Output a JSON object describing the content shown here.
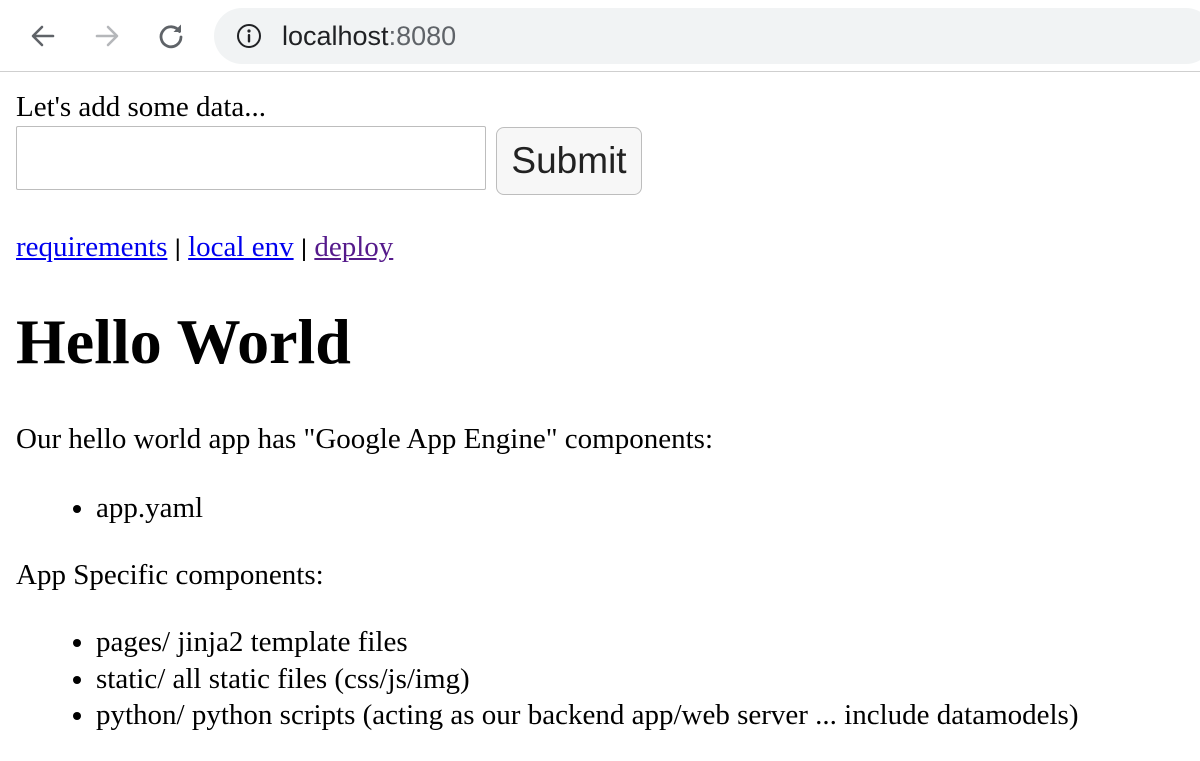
{
  "browser": {
    "url_host": "localhost",
    "url_port": ":8080",
    "icons": {
      "back": "arrow-left-icon",
      "forward": "arrow-right-icon",
      "reload": "reload-icon",
      "site_info": "info-circle-icon"
    }
  },
  "form": {
    "prompt": "Let's add some data...",
    "input_value": "",
    "submit_label": "Submit"
  },
  "links": [
    {
      "label": "requirements",
      "visited": false
    },
    {
      "label": "local env",
      "visited": false
    },
    {
      "label": "deploy",
      "visited": true
    }
  ],
  "link_separator": "|",
  "page": {
    "heading": "Hello World",
    "intro": "Our hello world app has \"Google App Engine\" components:",
    "gae_components": [
      "app.yaml"
    ],
    "app_heading": "App Specific components:",
    "app_components": [
      "pages/ jinja2 template files",
      "static/ all static files (css/js/img)",
      "python/ python scripts (acting as our backend app/web server ... include datamodels)"
    ]
  },
  "colors": {
    "link": "#0000ee",
    "visited_link": "#551a8b",
    "omnibox_bg": "#f1f3f4"
  }
}
